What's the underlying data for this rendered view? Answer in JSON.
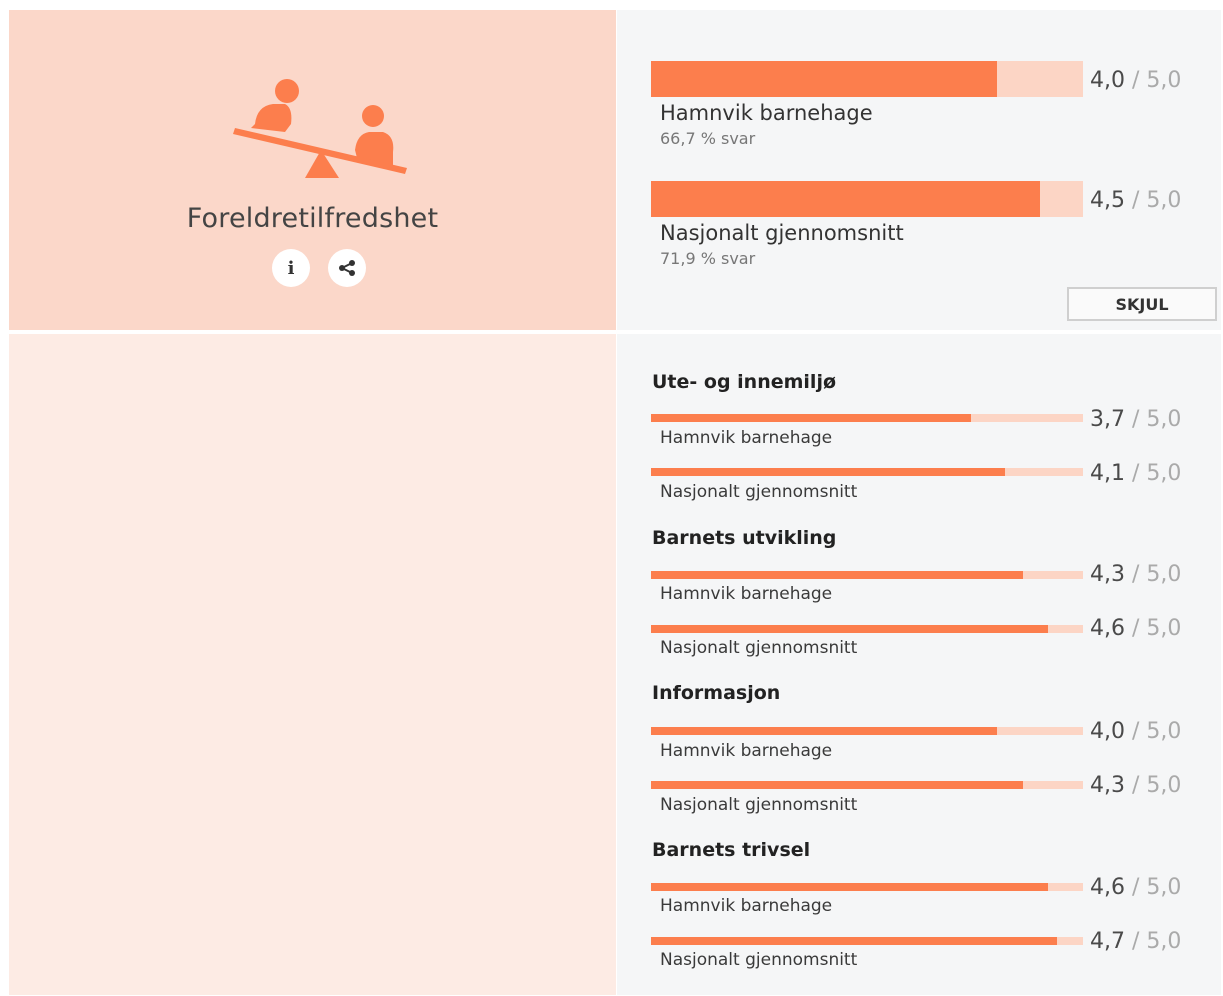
{
  "category": {
    "title": "Foreldretilfredshet",
    "icon": "seesaw-icon",
    "info_icon": "info-icon",
    "share_icon": "share-icon"
  },
  "summary": [
    {
      "label": "Hamnvik barnehage",
      "sub": "66,7 % svar",
      "value": "4,0",
      "max": "/ 5,0",
      "score": 4.0
    },
    {
      "label": "Nasjonalt gjennomsnitt",
      "sub": "71,9 % svar",
      "value": "4,5",
      "max": "/ 5,0",
      "score": 4.5
    }
  ],
  "toggle_button": "SKJUL",
  "sections": [
    {
      "title": "Ute- og innemiljø",
      "rows": [
        {
          "label": "Hamnvik barnehage",
          "value": "3,7",
          "max": "/ 5,0",
          "score": 3.7
        },
        {
          "label": "Nasjonalt gjennomsnitt",
          "value": "4,1",
          "max": "/ 5,0",
          "score": 4.1
        }
      ]
    },
    {
      "title": "Barnets utvikling",
      "rows": [
        {
          "label": "Hamnvik barnehage",
          "value": "4,3",
          "max": "/ 5,0",
          "score": 4.3
        },
        {
          "label": "Nasjonalt gjennomsnitt",
          "value": "4,6",
          "max": "/ 5,0",
          "score": 4.6
        }
      ]
    },
    {
      "title": "Informasjon",
      "rows": [
        {
          "label": "Hamnvik barnehage",
          "value": "4,0",
          "max": "/ 5,0",
          "score": 4.0
        },
        {
          "label": "Nasjonalt gjennomsnitt",
          "value": "4,3",
          "max": "/ 5,0",
          "score": 4.3
        }
      ]
    },
    {
      "title": "Barnets trivsel",
      "rows": [
        {
          "label": "Hamnvik barnehage",
          "value": "4,6",
          "max": "/ 5,0",
          "score": 4.6
        },
        {
          "label": "Nasjonalt gjennomsnitt",
          "value": "4,7",
          "max": "/ 5,0",
          "score": 4.7
        }
      ]
    }
  ],
  "scale_max": 5.0,
  "colors": {
    "accent": "#fc7e4d",
    "track": "#fcd5c5",
    "header_bg": "#fbd7c9",
    "body_bg": "#fdebe4"
  }
}
